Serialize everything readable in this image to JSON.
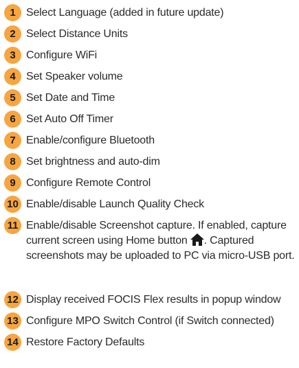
{
  "items": [
    {
      "num": "1",
      "text": "Select Language (added in future update)"
    },
    {
      "num": "2",
      "text": "Select Distance Units"
    },
    {
      "num": "3",
      "text": "Configure WiFi"
    },
    {
      "num": "4",
      "text": "Set Speaker volume"
    },
    {
      "num": "5",
      "text": "Set Date and Time"
    },
    {
      "num": "6",
      "text": "Set Auto Off Timer"
    },
    {
      "num": "7",
      "text": "Enable/configure Bluetooth"
    },
    {
      "num": "8",
      "text": "Set brightness and auto-dim"
    },
    {
      "num": "9",
      "text": "Configure Remote Control"
    },
    {
      "num": "10",
      "text": "Enable/disable Launch Quality Check"
    },
    {
      "num": "11",
      "text_before_icon": "Enable/disable Screenshot capture. If enabled, capture current screen using Home button",
      "text_after_icon": ". Captured screenshots may be uploaded to PC via micro-USB port.",
      "icon": "home-icon"
    },
    {
      "num": "12",
      "text": "Display received FOCIS Flex results in popup window"
    },
    {
      "num": "13",
      "text": "Configure MPO Switch Control (if Switch connected)"
    },
    {
      "num": "14",
      "text": "Restore Factory Defaults"
    }
  ],
  "colors": {
    "badge": "#f7a541",
    "text": "#2b2b2b"
  }
}
